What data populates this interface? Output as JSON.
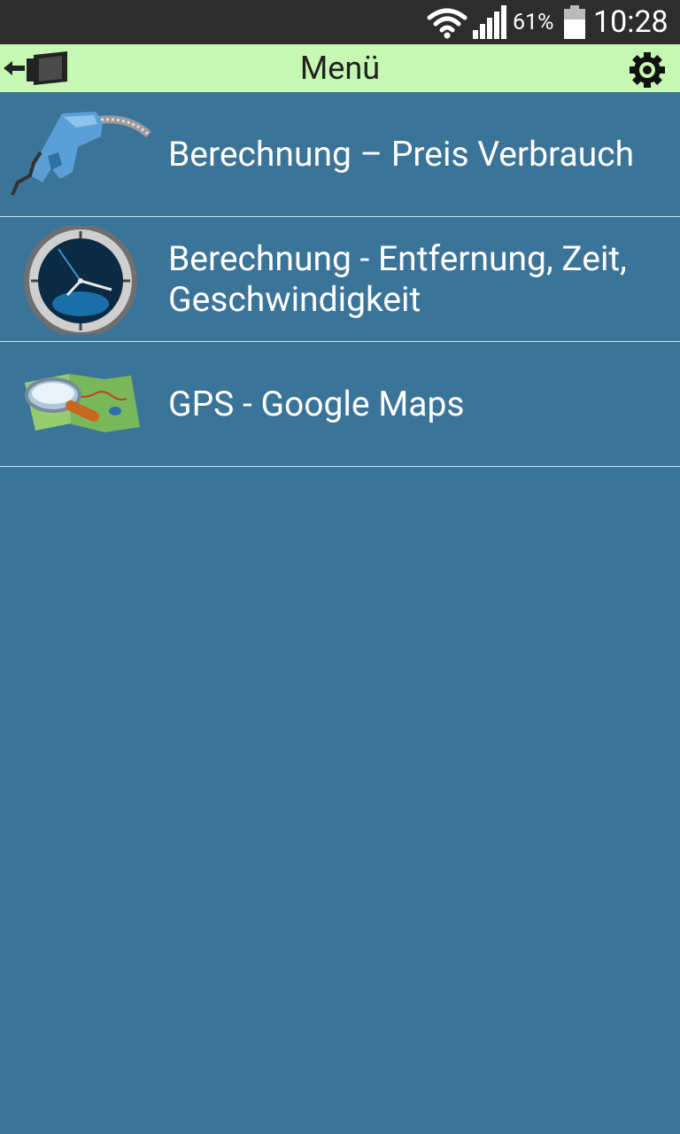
{
  "status_bar": {
    "battery_percent": "61%",
    "time": "10:28",
    "icons": [
      "wifi-icon",
      "signal-icon",
      "battery-icon"
    ]
  },
  "app_bar": {
    "title": "Menü",
    "background": "#c6f8b4",
    "back_icon": "exit-icon",
    "settings_icon": "gear-icon"
  },
  "menu": {
    "items": [
      {
        "label": "Berechnung – Preis Verbrauch",
        "icon": "fuel-nozzle-icon"
      },
      {
        "label": "Berechnung - Entfernung, Zeit, Geschwindigkeit",
        "icon": "clock-icon"
      },
      {
        "label": "GPS - Google Maps",
        "icon": "map-magnifier-icon"
      }
    ]
  },
  "colors": {
    "background": "#3b7499",
    "status_bar": "#2d2d2d",
    "divider": "#d6e2ea"
  }
}
